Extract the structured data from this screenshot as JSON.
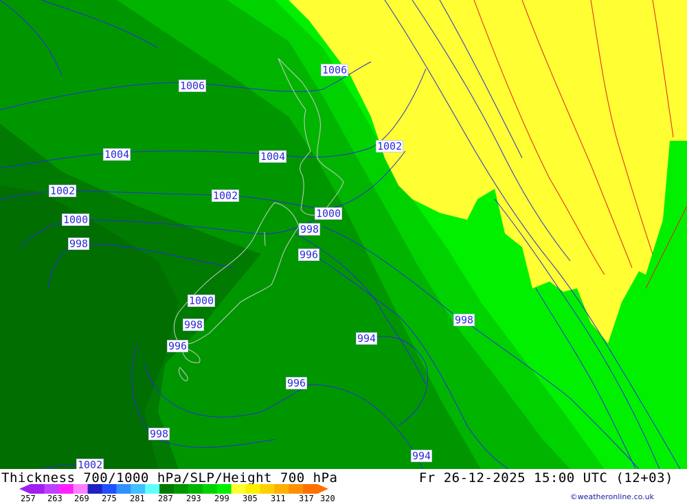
{
  "map": {
    "colors": {
      "dark_green": "#007a00",
      "green_mid": "#009600",
      "green": "#00b400",
      "green_bright": "#00d200",
      "lime": "#00f000",
      "yellow": "#ffff33",
      "isobar": "#2b2bd8",
      "thickness_line": "#e02020",
      "land_outline": "#cccccc"
    },
    "isobar_labels": [
      "1006",
      "1006",
      "1004",
      "1004",
      "1002",
      "1002",
      "1002",
      "1000",
      "1000",
      "998",
      "998",
      "996",
      "1000",
      "998",
      "996",
      "994",
      "998",
      "996",
      "998",
      "994",
      "1002"
    ]
  },
  "footer": {
    "title": "Thickness 700/1000 hPa/SLP/Height 700 hPa",
    "datetime": "Fr 26-12-2025 15:00 UTC (12+03)",
    "credit": "©weatheronline.co.uk",
    "legend_ticks": [
      "257",
      "263",
      "269",
      "275",
      "281",
      "287",
      "293",
      "299",
      "305",
      "311",
      "317",
      "320"
    ],
    "legend_colors": [
      "#a020f0",
      "#c040ff",
      "#ff20ff",
      "#ff80ff",
      "#2020c0",
      "#2050ff",
      "#3090ff",
      "#40c0ff",
      "#60ffff",
      "#007a00",
      "#009600",
      "#00b400",
      "#00d200",
      "#00f000",
      "#ffff33",
      "#fff000",
      "#ffd000",
      "#ffb000",
      "#ff9000",
      "#ff7000"
    ]
  }
}
